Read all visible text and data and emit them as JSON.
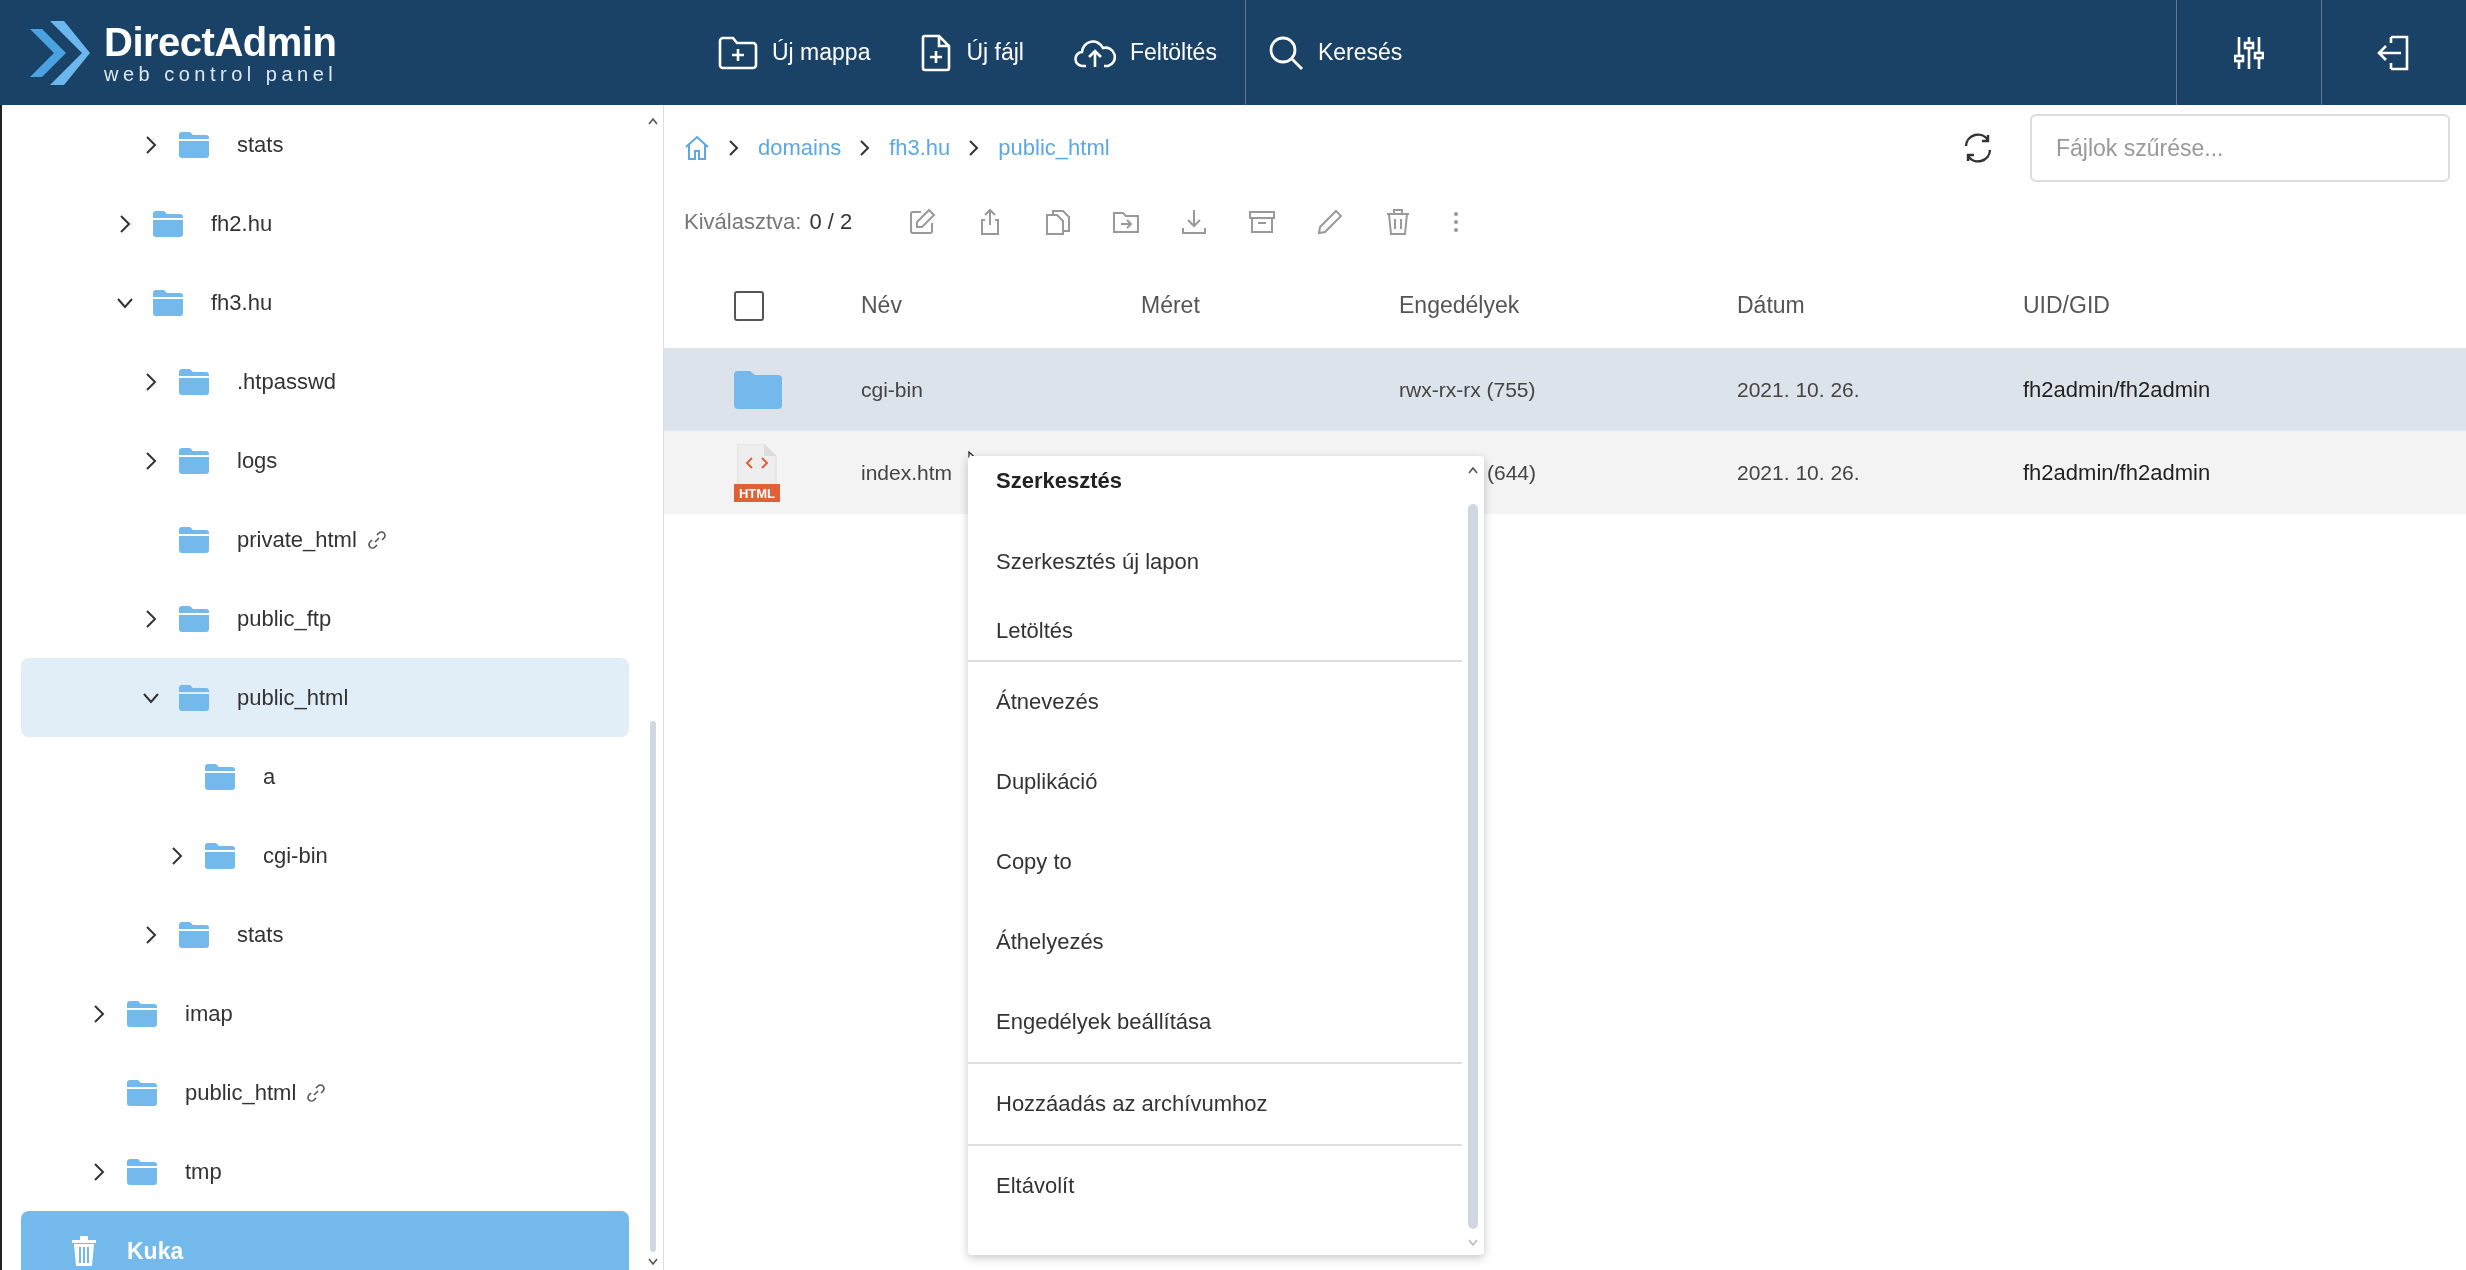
{
  "header": {
    "logo": {
      "name": "DirectAdmin",
      "tagline": "web control panel"
    },
    "actions": [
      {
        "kind": "new-folder",
        "label": "Új mappa",
        "separator_before": false
      },
      {
        "kind": "new-file",
        "label": "Új fájl",
        "separator_before": false
      },
      {
        "kind": "upload",
        "label": "Feltöltés",
        "separator_before": false
      },
      {
        "kind": "search",
        "label": "Keresés",
        "separator_before": true
      }
    ]
  },
  "sidebar": {
    "tree": [
      {
        "children": [
          {
            "children": [
              {
                "label": "stats",
                "expandable": true,
                "expanded": false,
                "linked": false,
                "selected": false
              }
            ]
          },
          {
            "label": "fh2.hu",
            "expandable": true,
            "expanded": false,
            "linked": false,
            "selected": false
          },
          {
            "label": "fh3.hu",
            "expandable": true,
            "expanded": true,
            "linked": false,
            "selected": false,
            "children": [
              {
                "label": ".htpasswd",
                "expandable": true,
                "expanded": false,
                "linked": false,
                "selected": false
              },
              {
                "label": "logs",
                "expandable": true,
                "expanded": false,
                "linked": false,
                "selected": false
              },
              {
                "label": "private_html",
                "linked": true,
                "selected": false
              },
              {
                "label": "public_ftp",
                "expandable": true,
                "expanded": false,
                "linked": false,
                "selected": false
              },
              {
                "label": "public_html",
                "expandable": true,
                "expanded": true,
                "linked": false,
                "selected": true,
                "children": [
                  {
                    "label": "a",
                    "linked": false,
                    "selected": false
                  },
                  {
                    "label": "cgi-bin",
                    "expandable": true,
                    "expanded": false,
                    "linked": false,
                    "selected": false
                  }
                ]
              },
              {
                "label": "stats",
                "expandable": true,
                "expanded": false,
                "linked": false,
                "selected": false
              }
            ]
          }
        ]
      },
      {
        "label": "imap",
        "expandable": true,
        "expanded": false,
        "linked": false,
        "selected": false
      },
      {
        "label": "public_html",
        "linked": true,
        "selected": false
      },
      {
        "label": "tmp",
        "expandable": true,
        "expanded": false,
        "linked": false,
        "selected": false
      }
    ],
    "trash": {
      "label": "Kuka"
    }
  },
  "breadcrumb": [
    "domains",
    "fh3.hu",
    "public_html"
  ],
  "filter": {
    "placeholder": "Fájlok szűrése..."
  },
  "selection": {
    "label": "Kiválasztva:",
    "count": "0 / 2"
  },
  "table": {
    "select_all": {
      "checked": false
    },
    "columns": [
      "Név",
      "Méret",
      "Engedélyek",
      "Dátum",
      "UID/GID"
    ],
    "rows": [
      {
        "kind": "folder",
        "name": "cgi-bin",
        "permissions": "rwx-rx-rx (755)",
        "date": "2021. 10. 26.",
        "owner": "fh2admin/fh2admin",
        "selected": true,
        "hovered": false
      },
      {
        "kind": "file",
        "icon_label": "HTML",
        "name": "index.htm",
        "permissions": "(644)",
        "date": "2021. 10. 26.",
        "owner": "fh2admin/fh2admin",
        "selected": false,
        "hovered": true
      }
    ]
  },
  "context_menu": {
    "items": [
      {
        "label": "Szerkesztés",
        "default": true,
        "separator_before": false
      },
      {
        "label": "Szerkesztés új lapon",
        "default": false,
        "separator_before": false
      },
      {
        "label": "Letöltés",
        "default": false,
        "separator_before": false
      },
      {
        "label": "Átnevezés",
        "default": false,
        "separator_before": true
      },
      {
        "label": "Duplikáció",
        "default": false,
        "separator_before": false
      },
      {
        "label": "Copy to",
        "default": false,
        "separator_before": false
      },
      {
        "label": "Áthelyezés",
        "default": false,
        "separator_before": false
      },
      {
        "label": "Engedélyek beállítása",
        "default": false,
        "separator_before": false
      },
      {
        "label": "Hozzáadás az archívumhoz",
        "default": false,
        "separator_before": true
      },
      {
        "label": "Eltávolít",
        "default": false,
        "separator_before": true
      }
    ]
  }
}
